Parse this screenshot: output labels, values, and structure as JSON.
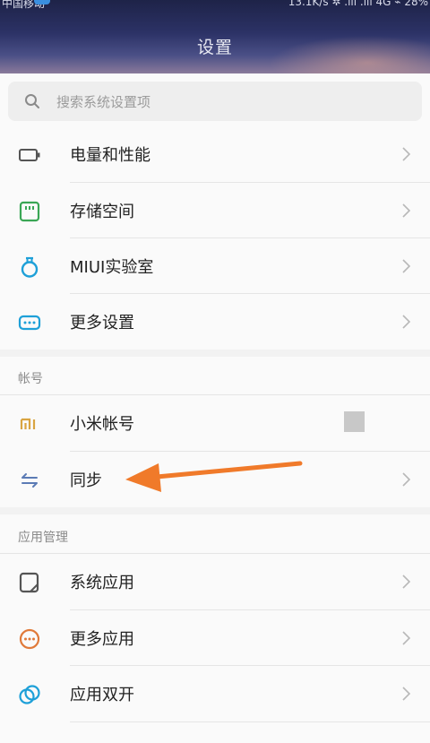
{
  "statusbar": {
    "left_text": "中国移动",
    "right_text": "13.1K/s ✲ .ıll .ıll 4G ⌁ 28%"
  },
  "header": {
    "title": "设置"
  },
  "search": {
    "placeholder": "搜索系统设置项"
  },
  "group1": {
    "items": [
      {
        "label": "电量和性能",
        "icon": "battery-icon",
        "color": "#555555"
      },
      {
        "label": "存储空间",
        "icon": "storage-icon",
        "color": "#3aa655"
      },
      {
        "label": "MIUI实验室",
        "icon": "lab-flask-icon",
        "color": "#1ea0d8"
      },
      {
        "label": "更多设置",
        "icon": "more-settings-icon",
        "color": "#1ea0d8"
      }
    ]
  },
  "account_section": {
    "title": "帐号",
    "items": [
      {
        "label": "小米帐号",
        "icon": "mi-logo-icon",
        "color": "#d9a441"
      },
      {
        "label": "同步",
        "icon": "sync-icon",
        "color": "#5b7bb5"
      }
    ]
  },
  "app_section": {
    "title": "应用管理",
    "items": [
      {
        "label": "系统应用",
        "icon": "system-app-icon",
        "color": "#555555"
      },
      {
        "label": "更多应用",
        "icon": "more-apps-icon",
        "color": "#e07a3a"
      },
      {
        "label": "应用双开",
        "icon": "dual-apps-icon",
        "color": "#1ea0d8"
      }
    ]
  },
  "annotation": {
    "arrow_color": "#f07a2a"
  }
}
